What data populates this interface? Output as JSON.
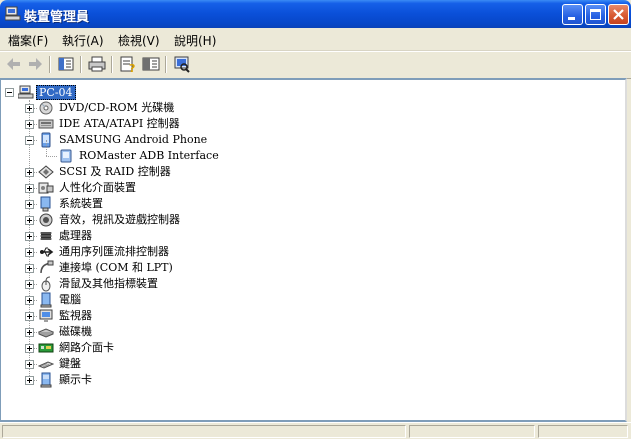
{
  "window": {
    "title": "裝置管理員"
  },
  "menu": [
    {
      "label": "檔案(F)"
    },
    {
      "label": "執行(A)"
    },
    {
      "label": "檢視(V)"
    },
    {
      "label": "說明(H)"
    }
  ],
  "toolbar": {
    "back": "back-arrow-icon",
    "forward": "forward-arrow-icon",
    "show_hide_tree": "console-tree-icon",
    "print": "printer-icon",
    "properties": "properties-icon",
    "help": "help-panel-icon",
    "scan": "scan-hardware-icon"
  },
  "tree": {
    "root": "PC-04",
    "items": [
      {
        "label": "DVD/CD-ROM 光碟機",
        "icon": "cdrom-icon",
        "expanded": false
      },
      {
        "label": "IDE ATA/ATAPI 控制器",
        "icon": "ide-controller-icon",
        "expanded": false
      },
      {
        "label": "SAMSUNG Android Phone",
        "icon": "phone-icon",
        "expanded": true,
        "children": [
          {
            "label": "ROMaster ADB Interface",
            "icon": "adb-device-icon"
          }
        ]
      },
      {
        "label": "SCSI 及 RAID 控制器",
        "icon": "scsi-icon",
        "expanded": false
      },
      {
        "label": "人性化介面裝置",
        "icon": "hid-icon",
        "expanded": false
      },
      {
        "label": "系統裝置",
        "icon": "system-device-icon",
        "expanded": false
      },
      {
        "label": "音效，視訊及遊戲控制器",
        "icon": "sound-icon",
        "expanded": false
      },
      {
        "label": "處理器",
        "icon": "processor-icon",
        "expanded": false
      },
      {
        "label": "通用序列匯流排控制器",
        "icon": "usb-icon",
        "expanded": false
      },
      {
        "label": "連接埠 (COM 和 LPT)",
        "icon": "port-icon",
        "expanded": false
      },
      {
        "label": "滑鼠及其他指標裝置",
        "icon": "mouse-icon",
        "expanded": false
      },
      {
        "label": "電腦",
        "icon": "computer-icon",
        "expanded": false
      },
      {
        "label": "監視器",
        "icon": "monitor-icon",
        "expanded": false
      },
      {
        "label": "磁碟機",
        "icon": "disk-drive-icon",
        "expanded": false
      },
      {
        "label": "網路介面卡",
        "icon": "network-adapter-icon",
        "expanded": false
      },
      {
        "label": "鍵盤",
        "icon": "keyboard-icon",
        "expanded": false
      },
      {
        "label": "顯示卡",
        "icon": "display-adapter-icon",
        "expanded": false
      }
    ]
  },
  "colors": {
    "titlebar": "#0a4fd8",
    "selection": "#316ac5",
    "face": "#ece9d8"
  }
}
